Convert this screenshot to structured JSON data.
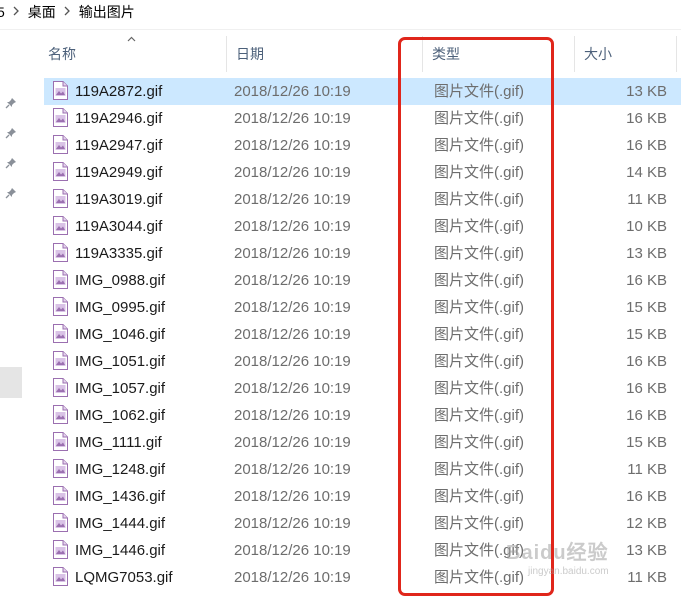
{
  "breadcrumb": {
    "partial_label": "5",
    "items": [
      "桌面",
      "输出图片"
    ]
  },
  "columns": {
    "name": "名称",
    "date": "日期",
    "type": "类型",
    "size": "大小"
  },
  "files": [
    {
      "name": "119A2872.gif",
      "date": "2018/12/26 10:19",
      "type": "图片文件(.gif)",
      "size": "13 KB"
    },
    {
      "name": "119A2946.gif",
      "date": "2018/12/26 10:19",
      "type": "图片文件(.gif)",
      "size": "16 KB"
    },
    {
      "name": "119A2947.gif",
      "date": "2018/12/26 10:19",
      "type": "图片文件(.gif)",
      "size": "16 KB"
    },
    {
      "name": "119A2949.gif",
      "date": "2018/12/26 10:19",
      "type": "图片文件(.gif)",
      "size": "14 KB"
    },
    {
      "name": "119A3019.gif",
      "date": "2018/12/26 10:19",
      "type": "图片文件(.gif)",
      "size": "11 KB"
    },
    {
      "name": "119A3044.gif",
      "date": "2018/12/26 10:19",
      "type": "图片文件(.gif)",
      "size": "10 KB"
    },
    {
      "name": "119A3335.gif",
      "date": "2018/12/26 10:19",
      "type": "图片文件(.gif)",
      "size": "13 KB"
    },
    {
      "name": "IMG_0988.gif",
      "date": "2018/12/26 10:19",
      "type": "图片文件(.gif)",
      "size": "16 KB"
    },
    {
      "name": "IMG_0995.gif",
      "date": "2018/12/26 10:19",
      "type": "图片文件(.gif)",
      "size": "15 KB"
    },
    {
      "name": "IMG_1046.gif",
      "date": "2018/12/26 10:19",
      "type": "图片文件(.gif)",
      "size": "15 KB"
    },
    {
      "name": "IMG_1051.gif",
      "date": "2018/12/26 10:19",
      "type": "图片文件(.gif)",
      "size": "16 KB"
    },
    {
      "name": "IMG_1057.gif",
      "date": "2018/12/26 10:19",
      "type": "图片文件(.gif)",
      "size": "16 KB"
    },
    {
      "name": "IMG_1062.gif",
      "date": "2018/12/26 10:19",
      "type": "图片文件(.gif)",
      "size": "16 KB"
    },
    {
      "name": "IMG_1111.gif",
      "date": "2018/12/26 10:19",
      "type": "图片文件(.gif)",
      "size": "15 KB"
    },
    {
      "name": "IMG_1248.gif",
      "date": "2018/12/26 10:19",
      "type": "图片文件(.gif)",
      "size": "11 KB"
    },
    {
      "name": "IMG_1436.gif",
      "date": "2018/12/26 10:19",
      "type": "图片文件(.gif)",
      "size": "16 KB"
    },
    {
      "name": "IMG_1444.gif",
      "date": "2018/12/26 10:19",
      "type": "图片文件(.gif)",
      "size": "12 KB"
    },
    {
      "name": "IMG_1446.gif",
      "date": "2018/12/26 10:19",
      "type": "图片文件(.gif)",
      "size": "13 KB"
    },
    {
      "name": "LQMG7053.gif",
      "date": "2018/12/26 10:19",
      "type": "图片文件(.gif)",
      "size": "11 KB"
    }
  ],
  "watermark": {
    "main": "Baidu经验",
    "sub": "jingyan.baidu.com"
  },
  "colors": {
    "highlight_box": "#e0261b",
    "selected_row": "#cce8ff"
  },
  "icons": {
    "breadcrumb_separator": "chevron-right-icon",
    "nav_pin": "pin-icon",
    "file": "gif-file-icon",
    "sort": "sort-ascending-icon"
  }
}
